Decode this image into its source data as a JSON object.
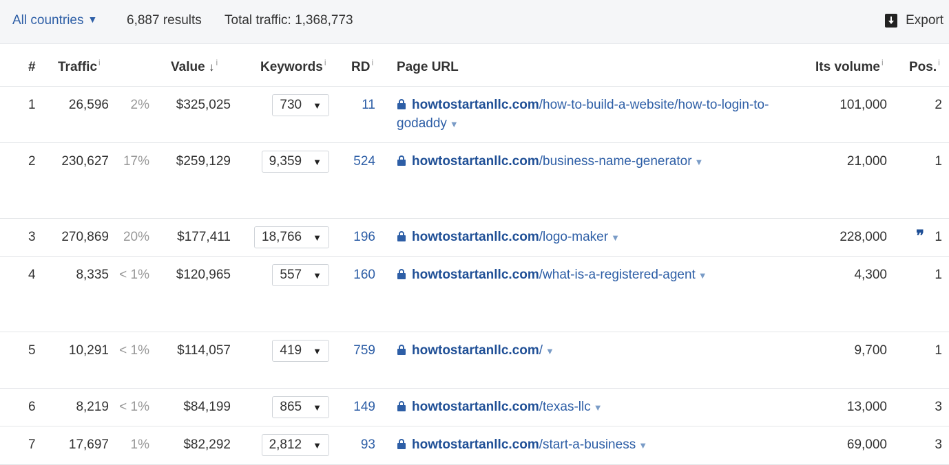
{
  "topbar": {
    "country_label": "All countries",
    "results": "6,887 results",
    "total_traffic": "Total traffic: 1,368,773",
    "export_label": "Export"
  },
  "headers": {
    "num": "#",
    "traffic": "Traffic",
    "value": "Value",
    "value_sort": "↓",
    "keywords": "Keywords",
    "rd": "RD",
    "page_url": "Page URL",
    "its_volume": "Its volume",
    "pos": "Pos.",
    "info": "i"
  },
  "rows": [
    {
      "num": "1",
      "traffic": "26,596",
      "share": "2%",
      "value": "$325,025",
      "keywords": "730",
      "rd": "11",
      "domain": "howtostartanllc.com",
      "path": "/how-to-build-a-website/how-to-login-to-godaddy",
      "volume": "101,000",
      "pos": "2"
    },
    {
      "num": "2",
      "traffic": "230,627",
      "share": "17%",
      "value": "$259,129",
      "keywords": "9,359",
      "rd": "524",
      "domain": "howtostartanllc.com",
      "path": "/business-name-generator",
      "volume": "21,000",
      "pos": "1"
    },
    {
      "num": "3",
      "traffic": "270,869",
      "share": "20%",
      "value": "$177,411",
      "keywords": "18,766",
      "rd": "196",
      "domain": "howtostartanllc.com",
      "path": "/logo-maker",
      "volume": "228,000",
      "pos": "1",
      "quote": "❞"
    },
    {
      "num": "4",
      "traffic": "8,335",
      "share": "< 1%",
      "value": "$120,965",
      "keywords": "557",
      "rd": "160",
      "domain": "howtostartanllc.com",
      "path": "/what-is-a-registered-agent",
      "volume": "4,300",
      "pos": "1"
    },
    {
      "num": "5",
      "traffic": "10,291",
      "share": "< 1%",
      "value": "$114,057",
      "keywords": "419",
      "rd": "759",
      "domain": "howtostartanllc.com",
      "path": "/",
      "volume": "9,700",
      "pos": "1"
    },
    {
      "num": "6",
      "traffic": "8,219",
      "share": "< 1%",
      "value": "$84,199",
      "keywords": "865",
      "rd": "149",
      "domain": "howtostartanllc.com",
      "path": "/texas-llc",
      "volume": "13,000",
      "pos": "3"
    },
    {
      "num": "7",
      "traffic": "17,697",
      "share": "1%",
      "value": "$82,292",
      "keywords": "2,812",
      "rd": "93",
      "domain": "howtostartanllc.com",
      "path": "/start-a-business",
      "volume": "69,000",
      "pos": "3"
    }
  ],
  "icons": {
    "dropdown": "▼",
    "export": "export-download-icon",
    "lock": "lock-icon",
    "quote": "quote-icon"
  },
  "colors": {
    "link": "#2d5ea6",
    "domain": "#1f4f96",
    "muted": "#999999",
    "topbar_bg": "#f5f6f8"
  }
}
